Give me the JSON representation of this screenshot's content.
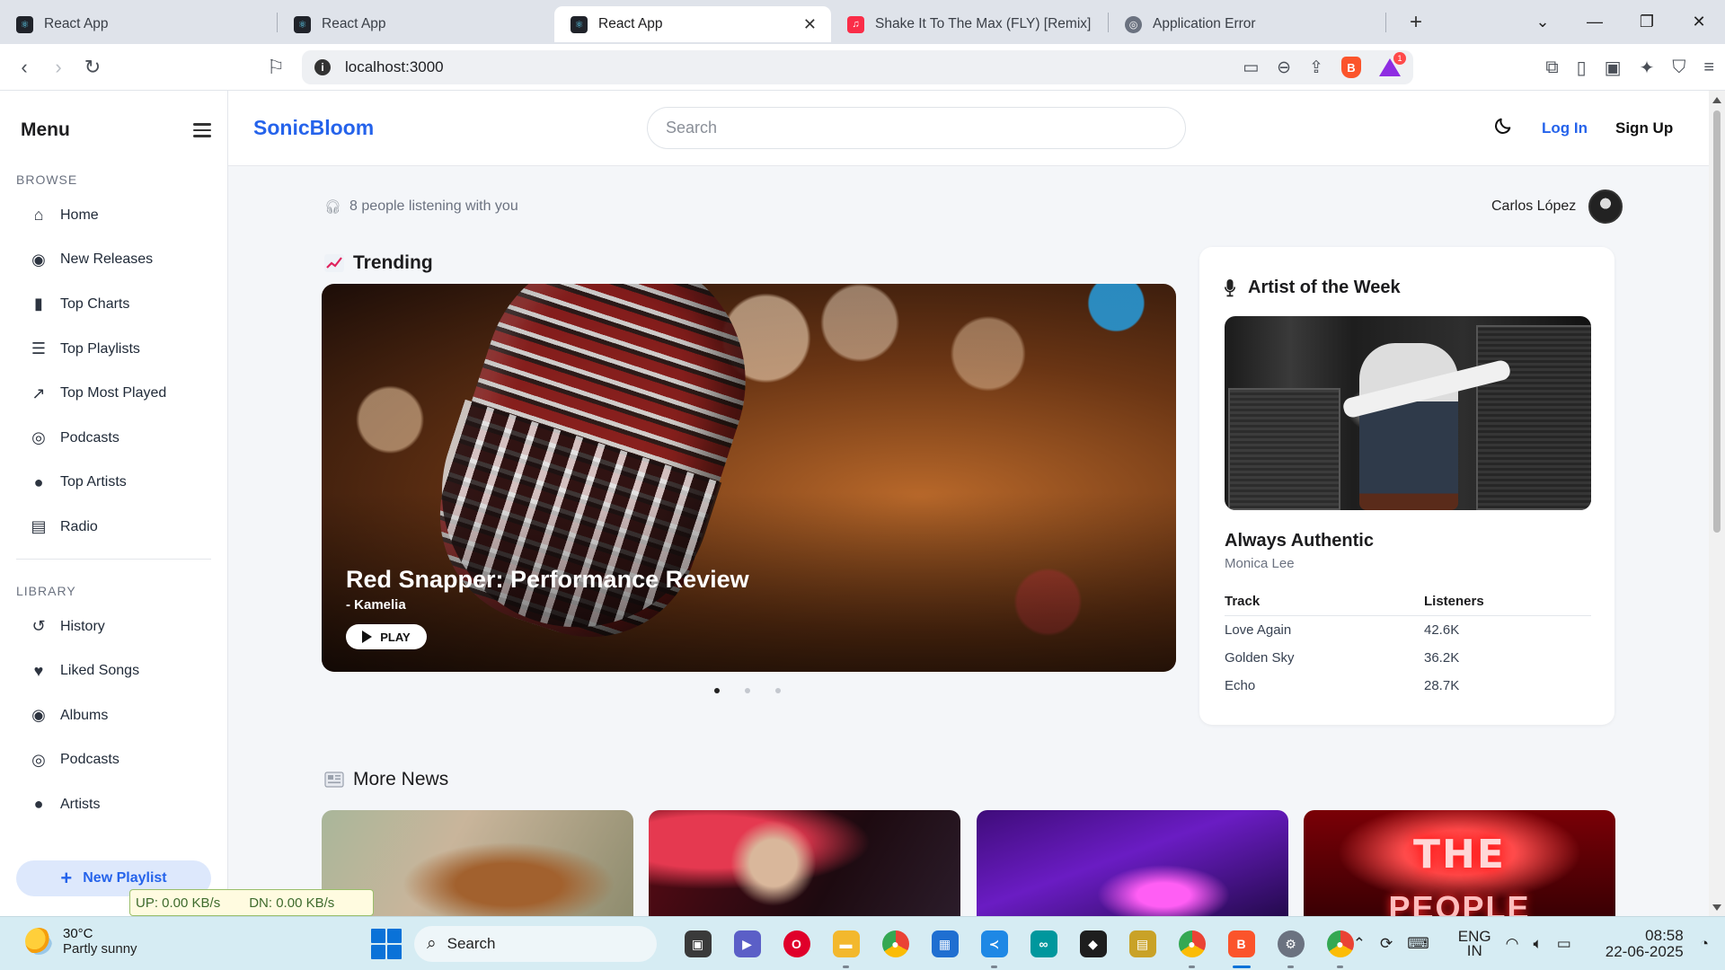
{
  "browser": {
    "tabs": [
      {
        "title": "React App",
        "icon": "react-icon",
        "active": false
      },
      {
        "title": "React App",
        "icon": "react-icon",
        "active": false
      },
      {
        "title": "React App",
        "icon": "react-icon",
        "active": true
      },
      {
        "title": "Shake It To The Max (FLY) [Remix] – S",
        "icon": "music-icon",
        "active": false
      },
      {
        "title": "Application Error",
        "icon": "globe-icon",
        "active": false
      }
    ],
    "url": "localhost:3000",
    "notification_count": "1"
  },
  "sidebar": {
    "title": "Menu",
    "browse_heading": "BROWSE",
    "browse_items": [
      {
        "label": "Home",
        "icon": "home-icon"
      },
      {
        "label": "New Releases",
        "icon": "compass-icon"
      },
      {
        "label": "Top Charts",
        "icon": "bar-chart-icon"
      },
      {
        "label": "Top Playlists",
        "icon": "playlist-icon"
      },
      {
        "label": "Top Most Played",
        "icon": "trending-icon"
      },
      {
        "label": "Podcasts",
        "icon": "podcast-icon"
      },
      {
        "label": "Top Artists",
        "icon": "person-icon"
      },
      {
        "label": "Radio",
        "icon": "radio-icon"
      }
    ],
    "library_heading": "LIBRARY",
    "library_items": [
      {
        "label": "History",
        "icon": "history-icon"
      },
      {
        "label": "Liked Songs",
        "icon": "heart-icon"
      },
      {
        "label": "Albums",
        "icon": "album-icon"
      },
      {
        "label": "Podcasts",
        "icon": "podcast-icon"
      },
      {
        "label": "Artists",
        "icon": "person-icon"
      }
    ],
    "new_playlist_label": "New Playlist"
  },
  "header": {
    "brand": "SonicBloom",
    "search_placeholder": "Search",
    "login_label": "Log In",
    "signup_label": "Sign Up",
    "accent_color": "#2563eb"
  },
  "main": {
    "listening_text": "8 people listening with you",
    "user_name": "Carlos López",
    "trending_title": "Trending",
    "hero": {
      "title": "Red Snapper: Performance Review",
      "artist": "- Kamelia",
      "play_label": "PLAY",
      "slide_count": 3,
      "active_slide": 1
    },
    "artist_of_week": {
      "heading": "Artist of the Week",
      "song": "Always Authentic",
      "artist": "Monica Lee",
      "columns": [
        "Track",
        "Listeners"
      ],
      "rows": [
        [
          "Love Again",
          "42.6K"
        ],
        [
          "Golden Sky",
          "36.2K"
        ],
        [
          "Echo",
          "28.7K"
        ]
      ]
    },
    "more_news_title": "More News",
    "news_card_text": [
      "THE",
      "PEOPLE"
    ]
  },
  "netmeter": {
    "up": "UP: 0.00 KB/s",
    "down": "DN: 0.00 KB/s"
  },
  "taskbar": {
    "temperature": "30°C",
    "weather": "Partly sunny",
    "search_label": "Search",
    "lang_line1": "ENG",
    "lang_line2": "IN",
    "time": "08:58",
    "date": "22-06-2025"
  }
}
